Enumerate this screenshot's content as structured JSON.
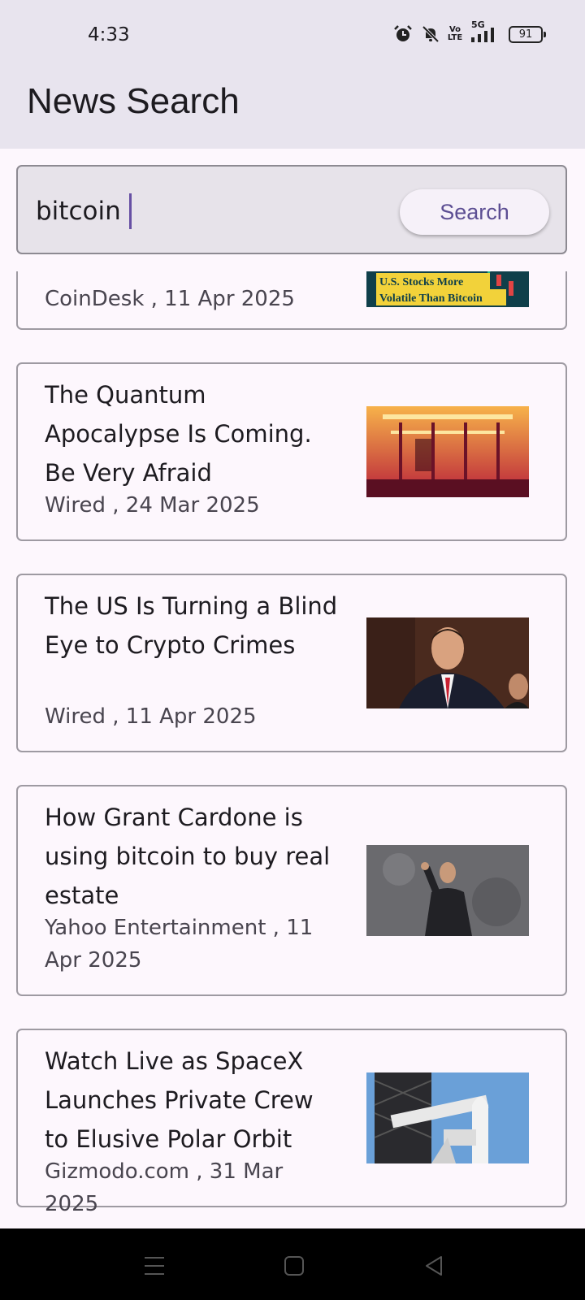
{
  "status_bar": {
    "time": "4:33",
    "icons": [
      "alarm-icon",
      "bell-off-icon",
      "volte-icon",
      "5g-signal-icon",
      "battery-icon"
    ],
    "volte_text": "Vo LTE",
    "network_text": "5G",
    "battery": "91"
  },
  "app_bar": {
    "title": "News Search"
  },
  "search": {
    "value": "bitcoin",
    "button_label": "Search"
  },
  "articles": [
    {
      "title": "",
      "source_date": "CoinDesk , 11 Apr 2025",
      "thumb_text_1": "U.S. Stocks More",
      "thumb_text_2": "Volatile Than Bitcoin"
    },
    {
      "title": "The Quantum Apocalypse Is Coming. Be Very Afraid",
      "source_date": "Wired , 24 Mar 2025"
    },
    {
      "title": "The US Is Turning a Blind Eye to Crypto Crimes",
      "source_date": "Wired , 11 Apr 2025"
    },
    {
      "title": "How Grant Cardone is using bitcoin to buy real estate",
      "source_date": "Yahoo Entertainment , 11 Apr 2025"
    },
    {
      "title": "Watch Live as SpaceX Launches Private Crew to Elusive Polar Orbit",
      "source_date": "Gizmodo.com , 31 Mar 2025"
    }
  ],
  "nav": {
    "icons": [
      "menu-icon",
      "home-icon",
      "back-icon"
    ]
  },
  "colors": {
    "accent": "#6750a4",
    "app_bar": "#e8e4ee",
    "background": "#fdf7fd"
  }
}
